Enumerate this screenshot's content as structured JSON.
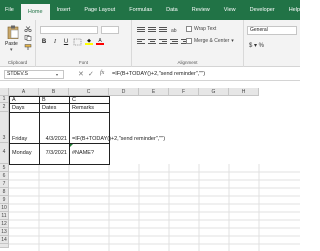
{
  "ribbon": {
    "tabs": [
      "File",
      "Home",
      "Insert",
      "Page Layout",
      "Formulas",
      "Data",
      "Review",
      "View",
      "Developer",
      "Help",
      "Pow"
    ],
    "active_tab": "Home",
    "clipboard": {
      "paste_label": "Paste",
      "group_label": "Clipboard"
    },
    "font": {
      "group_label": "Font"
    },
    "alignment": {
      "group_label": "Alignment",
      "wrap_text": "Wrap Text",
      "merge_center": "Merge & Center"
    },
    "number": {
      "format": "General"
    }
  },
  "formula_bar": {
    "name_box": "STDEV.S",
    "formula": "=IF(B+TODAY()+2,\"send reminder\",\"\")"
  },
  "sheet": {
    "columns": [
      "A",
      "B",
      "C",
      "D",
      "E",
      "F",
      "G",
      "H"
    ],
    "rows": [
      "1",
      "2",
      "3",
      "4",
      "5",
      "6",
      "7",
      "8",
      "9",
      "10",
      "11",
      "12",
      "13",
      "14",
      "15",
      "16",
      "17",
      "18"
    ],
    "cells": {
      "A1": "A",
      "B1": "B",
      "C1": "C",
      "A2": "Days",
      "B2": "Dates",
      "C2": "Remarks",
      "A3": "Friday",
      "B3": "4/3/2021",
      "C3": "=IF(B+TODAY()+2,\"send reminder\",\"\")",
      "A4": "Monday",
      "B4": "7/3/2021",
      "C4": "#NAME?"
    }
  },
  "colors": {
    "brand": "#217346",
    "ribbon_bg": "#f3f3f3",
    "header_bg": "#e6e6e6",
    "error_flag": "#1e7d32"
  }
}
